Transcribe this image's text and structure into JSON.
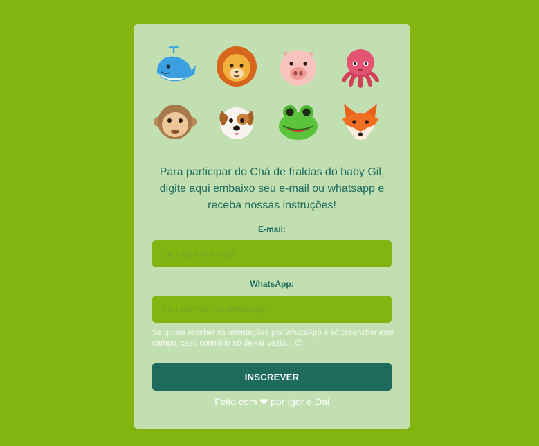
{
  "emojis": [
    "whale-emoji",
    "lion-emoji",
    "pig-emoji",
    "octopus-emoji",
    "monkey-emoji",
    "dog-emoji",
    "frog-emoji",
    "fox-emoji"
  ],
  "intro_text": "Para participar do Chá de fraldas do baby Gil, digite aqui embaixo seu e-mail ou whatsapp e receba nossas instruções!",
  "email": {
    "label": "E-mail:",
    "placeholder": "Seu melhor e-mail",
    "value": ""
  },
  "whatsapp": {
    "label": "WhatsApp:",
    "placeholder": "Seu número de WhatsApp",
    "value": ""
  },
  "hint": "Se quiser receber as orientações por WhatsApp é só preencher este campo, caso contrário só deixar vazio... 😊",
  "submit_label": "INSCREVER",
  "footer": "Feito com ❤ por Igor e Dai",
  "colors": {
    "page_background": "#82b412",
    "card_background": "#c1dfb1",
    "accent_dark": "#1e6a5d",
    "input_background": "#82b412"
  }
}
